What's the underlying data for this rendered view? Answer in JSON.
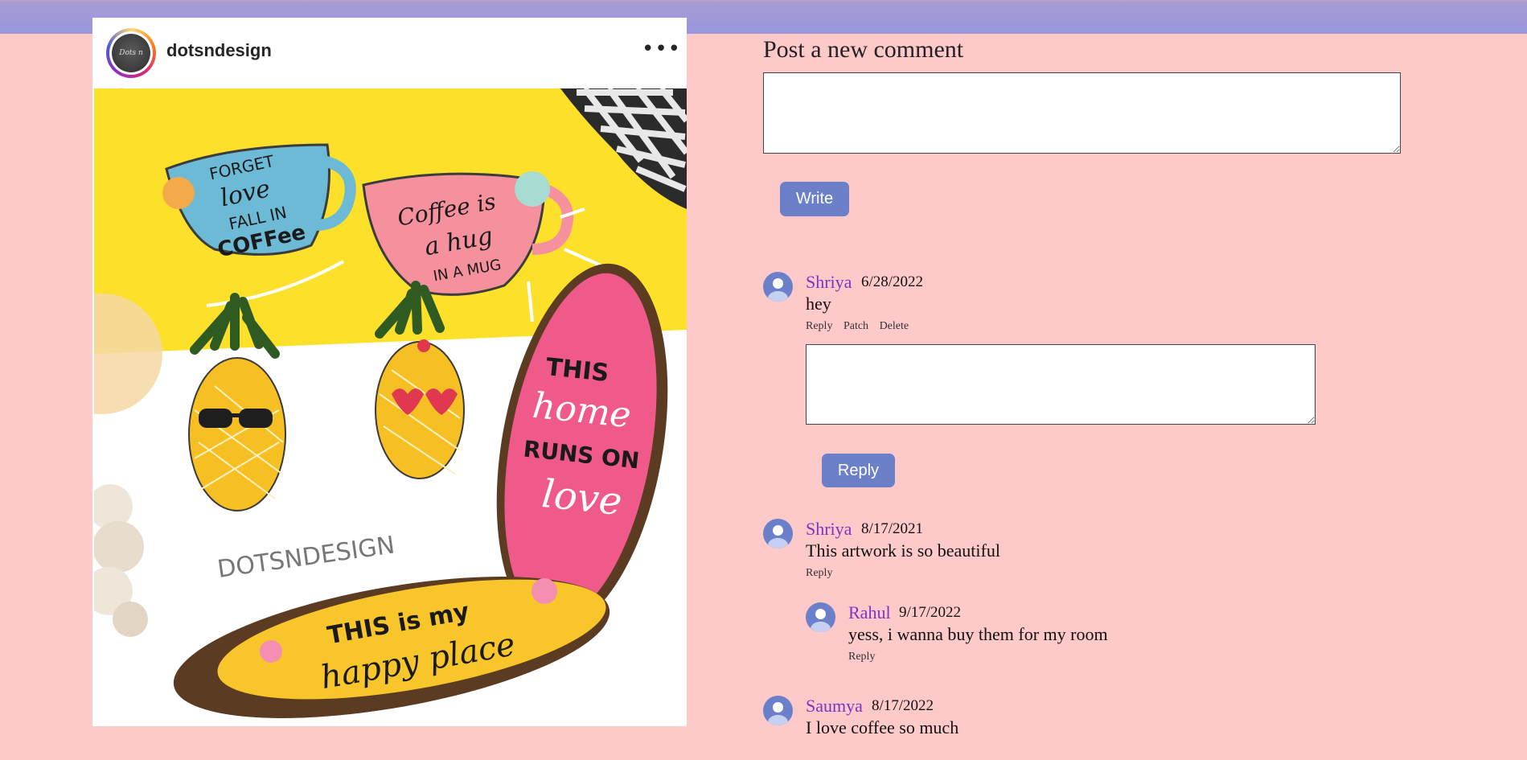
{
  "post": {
    "username": "dotsndesign",
    "avatar_text": "Dots n Design",
    "more_label": "•••",
    "image": {
      "cup1_lines": [
        "FORGET",
        "love",
        "FALL IN",
        "COFFee"
      ],
      "cup2_lines": [
        "Coffee is",
        "a hug",
        "IN A MUG"
      ],
      "oval_lines": [
        "THIS",
        "home",
        "RUNS ON",
        "love"
      ],
      "watermark": "DOTSNDESIGN",
      "plank_lines": [
        "THIS is my",
        "happy place"
      ]
    }
  },
  "new_comment": {
    "title": "Post a new comment",
    "textarea_value": "",
    "write_label": "Write"
  },
  "comments": [
    {
      "author": "Shriya",
      "date": "6/28/2022",
      "text": "hey",
      "actions": [
        "Reply",
        "Patch",
        "Delete"
      ],
      "reply_box_value": "",
      "reply_button_label": "Reply"
    },
    {
      "author": "Shriya",
      "date": "8/17/2021",
      "text": "This artwork is so beautiful",
      "actions": [
        "Reply"
      ],
      "replies": [
        {
          "author": "Rahul",
          "date": "9/17/2022",
          "text": "yess, i wanna buy them for my room",
          "actions": [
            "Reply"
          ]
        }
      ]
    },
    {
      "author": "Saumya",
      "date": "8/17/2022",
      "text": "I love coffee so much"
    }
  ],
  "colors": {
    "page_background": "#fdc9c9",
    "top_bar": "#9a97de",
    "button": "#6b80c9",
    "author": "#7a35c7",
    "avatar": "#6c7fcb"
  }
}
